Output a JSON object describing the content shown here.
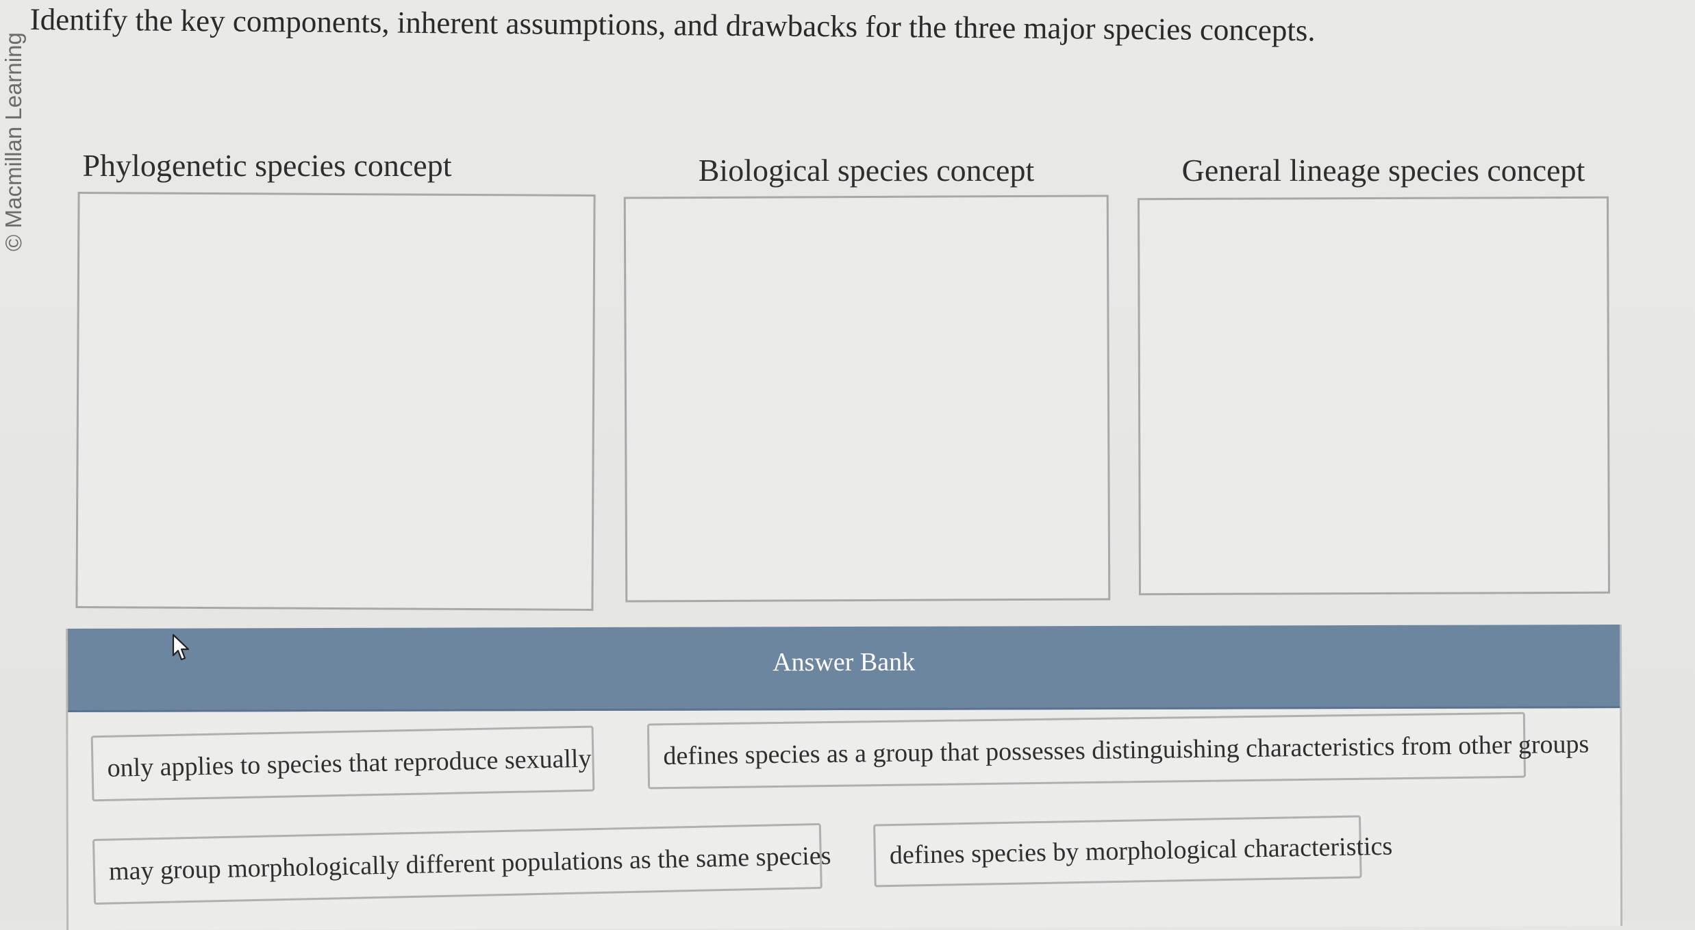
{
  "watermark": "© Macmillan Learning",
  "question": "Identify the key components, inherent assumptions, and drawbacks for the three major species concepts.",
  "categories": [
    {
      "label": "Phylogenetic species concept"
    },
    {
      "label": "Biological species concept"
    },
    {
      "label": "General lineage species concept"
    }
  ],
  "answer_bank": {
    "title": "Answer Bank",
    "items": [
      {
        "label": "only applies to species that reproduce sexually"
      },
      {
        "label": "defines species as a group that possesses distinguishing characteristics from other groups"
      },
      {
        "label": "may group morphologically different populations as the same species"
      },
      {
        "label": "defines species by morphological characteristics"
      }
    ]
  },
  "colors": {
    "bank_header": "#6d86a0",
    "background": "#e6e6e4"
  },
  "icons": {
    "cursor": "mouse-pointer-icon"
  }
}
